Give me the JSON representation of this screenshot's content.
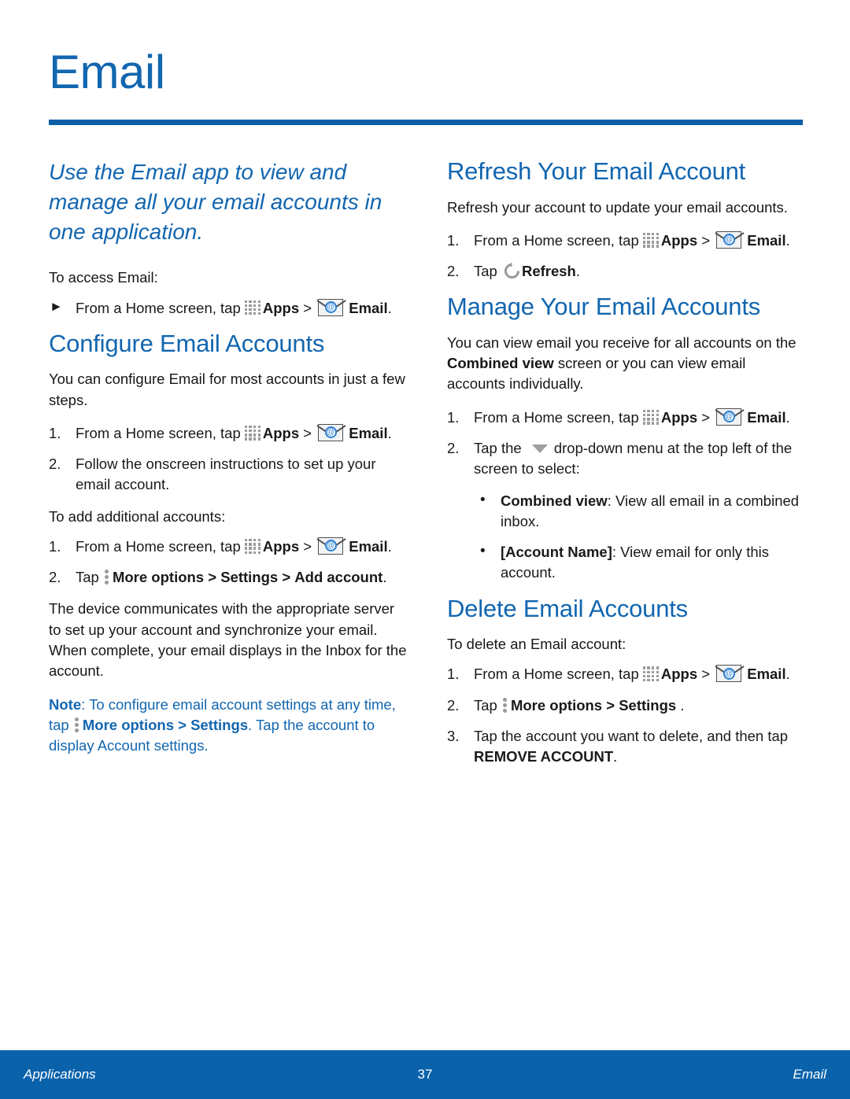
{
  "page": {
    "title": "Email",
    "accent_blue": "#1266b0",
    "rule_blue": "#0a5fa6",
    "footer_blue": "#0a62ab"
  },
  "left_column": {
    "intro": "Use the Email app to view and manage all your email accounts in one application.",
    "access_lead": "To access Email:",
    "access_step": {
      "prefix": "From a Home screen, tap",
      "apps": "Apps",
      "gt": ">",
      "email": "Email",
      "period": "."
    },
    "configure": {
      "heading": "Configure Email Accounts",
      "intro": "You can configure Email for most accounts in just a few steps.",
      "step1": {
        "num": "1.",
        "prefix": "From a Home screen, tap",
        "apps": "Apps",
        "gt": ">",
        "email": "Email",
        "period": "."
      },
      "step2": {
        "num": "2.",
        "text": "Follow the onscreen instructions to set up your email account."
      },
      "add_lead": "To add additional accounts:",
      "add_step1": {
        "num": "1.",
        "prefix": "From a Home screen, tap",
        "apps": "Apps",
        "gt": ">",
        "email": "Email",
        "period": "."
      },
      "add_step2": {
        "num": "2.",
        "tap": "Tap",
        "more_options": "More options",
        "gt1": ">",
        "settings": "Settings",
        "gt2": ">",
        "add_account": "Add account",
        "period": "."
      },
      "outro": "The device communicates with the appropriate server to set up your account and synchronize your email. When complete, your email displays in the Inbox for the account.",
      "note": {
        "label": "Note",
        "text1": ": To configure email account settings at any time, tap",
        "more_options": "More options",
        "gt": ">",
        "settings": "Settings",
        "text2": ". Tap the account to display Account settings."
      }
    }
  },
  "right_column": {
    "refresh": {
      "heading": "Refresh Your Email Account",
      "intro": "Refresh your account to update your email accounts.",
      "step1": {
        "num": "1.",
        "prefix": "From a Home screen, tap",
        "apps": "Apps",
        "gt": ">",
        "email": "Email",
        "period": "."
      },
      "step2": {
        "num": "2.",
        "tap": "Tap",
        "refresh": "Refresh",
        "period": "."
      }
    },
    "manage": {
      "heading": "Manage Your Email Accounts",
      "intro_a": "You can view email you receive for all accounts on the",
      "intro_bold": "Combined view",
      "intro_b": "screen or you can view email accounts individually.",
      "step1": {
        "num": "1.",
        "prefix": "From a Home screen, tap",
        "apps": "Apps",
        "gt": ">",
        "email": "Email",
        "period": "."
      },
      "step2": {
        "num": "2.",
        "text_a": "Tap the",
        "text_b": "drop-down menu at the top left of the screen to select:"
      },
      "bullets": [
        {
          "bold": "Combined view",
          "rest": ": View all email in a combined inbox."
        },
        {
          "bold": "[Account Name]",
          "rest": ": View email for only this account."
        }
      ]
    },
    "delete": {
      "heading": "Delete Email Accounts",
      "intro": "To delete an Email account:",
      "step1": {
        "num": "1.",
        "prefix": "From a Home screen, tap",
        "apps": "Apps",
        "gt": ">",
        "email": "Email",
        "period": "."
      },
      "step2": {
        "num": "2.",
        "tap": "Tap",
        "more_options": "More options",
        "gt": ">",
        "settings": "Settings",
        "period": "."
      },
      "step3": {
        "num": "3.",
        "text": "Tap the account you want to delete, and then tap",
        "bold": "REMOVE ACCOUNT",
        "period": "."
      }
    }
  },
  "footer": {
    "left": "Applications",
    "center": "37",
    "right": "Email"
  },
  "icons": {
    "apps": "apps-grid-icon",
    "email": "email-envelope-icon",
    "more_options": "more-options-vertical-dots-icon",
    "refresh": "refresh-circular-arrow-icon",
    "dropdown": "chevron-down-triangle-icon"
  }
}
